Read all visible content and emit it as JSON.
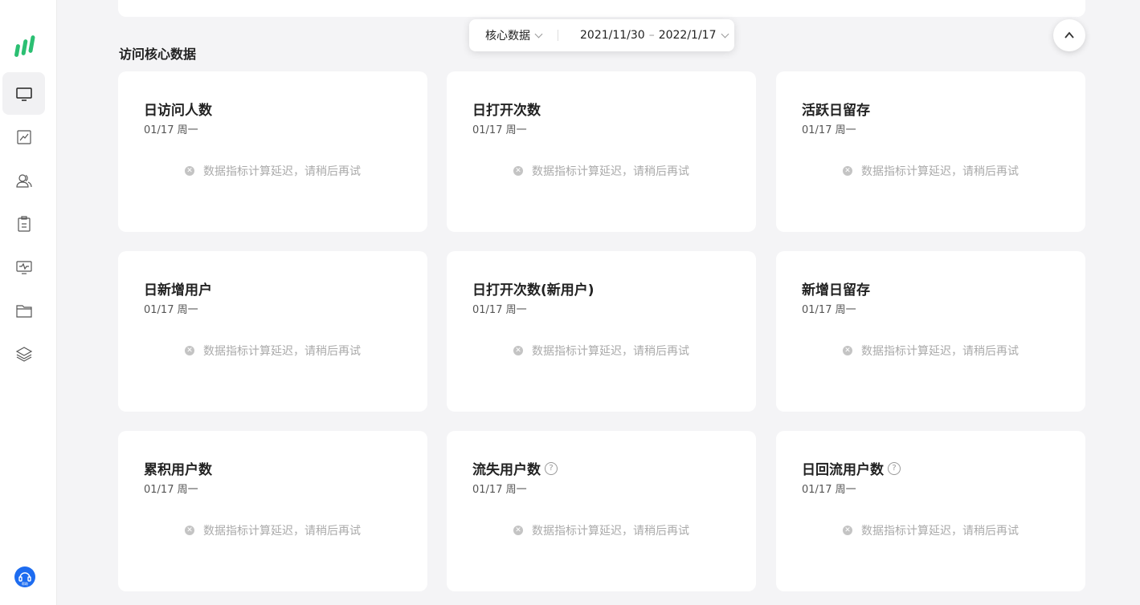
{
  "header": {
    "section_title": "访问核心数据",
    "metric_select": "核心数据",
    "date_start": "2021/11/30",
    "date_sep": "–",
    "date_end": "2022/1/17"
  },
  "sidebar": {
    "items": [
      {
        "icon": "monitor-icon",
        "active": true
      },
      {
        "icon": "trend-chart-icon",
        "active": false
      },
      {
        "icon": "users-icon",
        "active": false
      },
      {
        "icon": "clipboard-icon",
        "active": false
      },
      {
        "icon": "performance-monitor-icon",
        "active": false
      },
      {
        "icon": "folder-icon",
        "active": false
      },
      {
        "icon": "layers-icon",
        "active": false
      }
    ]
  },
  "cards": [
    {
      "title": "日访问人数",
      "date": "01/17 周一",
      "message": "数据指标计算延迟，请稍后再试",
      "help": false
    },
    {
      "title": "日打开次数",
      "date": "01/17 周一",
      "message": "数据指标计算延迟，请稍后再试",
      "help": false
    },
    {
      "title": "活跃日留存",
      "date": "01/17 周一",
      "message": "数据指标计算延迟，请稍后再试",
      "help": false
    },
    {
      "title": "日新增用户",
      "date": "01/17 周一",
      "message": "数据指标计算延迟，请稍后再试",
      "help": false
    },
    {
      "title": "日打开次数(新用户)",
      "date": "01/17 周一",
      "message": "数据指标计算延迟，请稍后再试",
      "help": false
    },
    {
      "title": "新增日留存",
      "date": "01/17 周一",
      "message": "数据指标计算延迟，请稍后再试",
      "help": false
    },
    {
      "title": "累积用户数",
      "date": "01/17 周一",
      "message": "数据指标计算延迟，请稍后再试",
      "help": false
    },
    {
      "title": "流失用户数",
      "date": "01/17 周一",
      "message": "数据指标计算延迟，请稍后再试",
      "help": true
    },
    {
      "title": "日回流用户数",
      "date": "01/17 周一",
      "message": "数据指标计算延迟，请稍后再试",
      "help": true
    }
  ],
  "colors": {
    "brand": "#2bbf72",
    "help_button": "#1d6cf0"
  },
  "help_button_text": "帮助"
}
